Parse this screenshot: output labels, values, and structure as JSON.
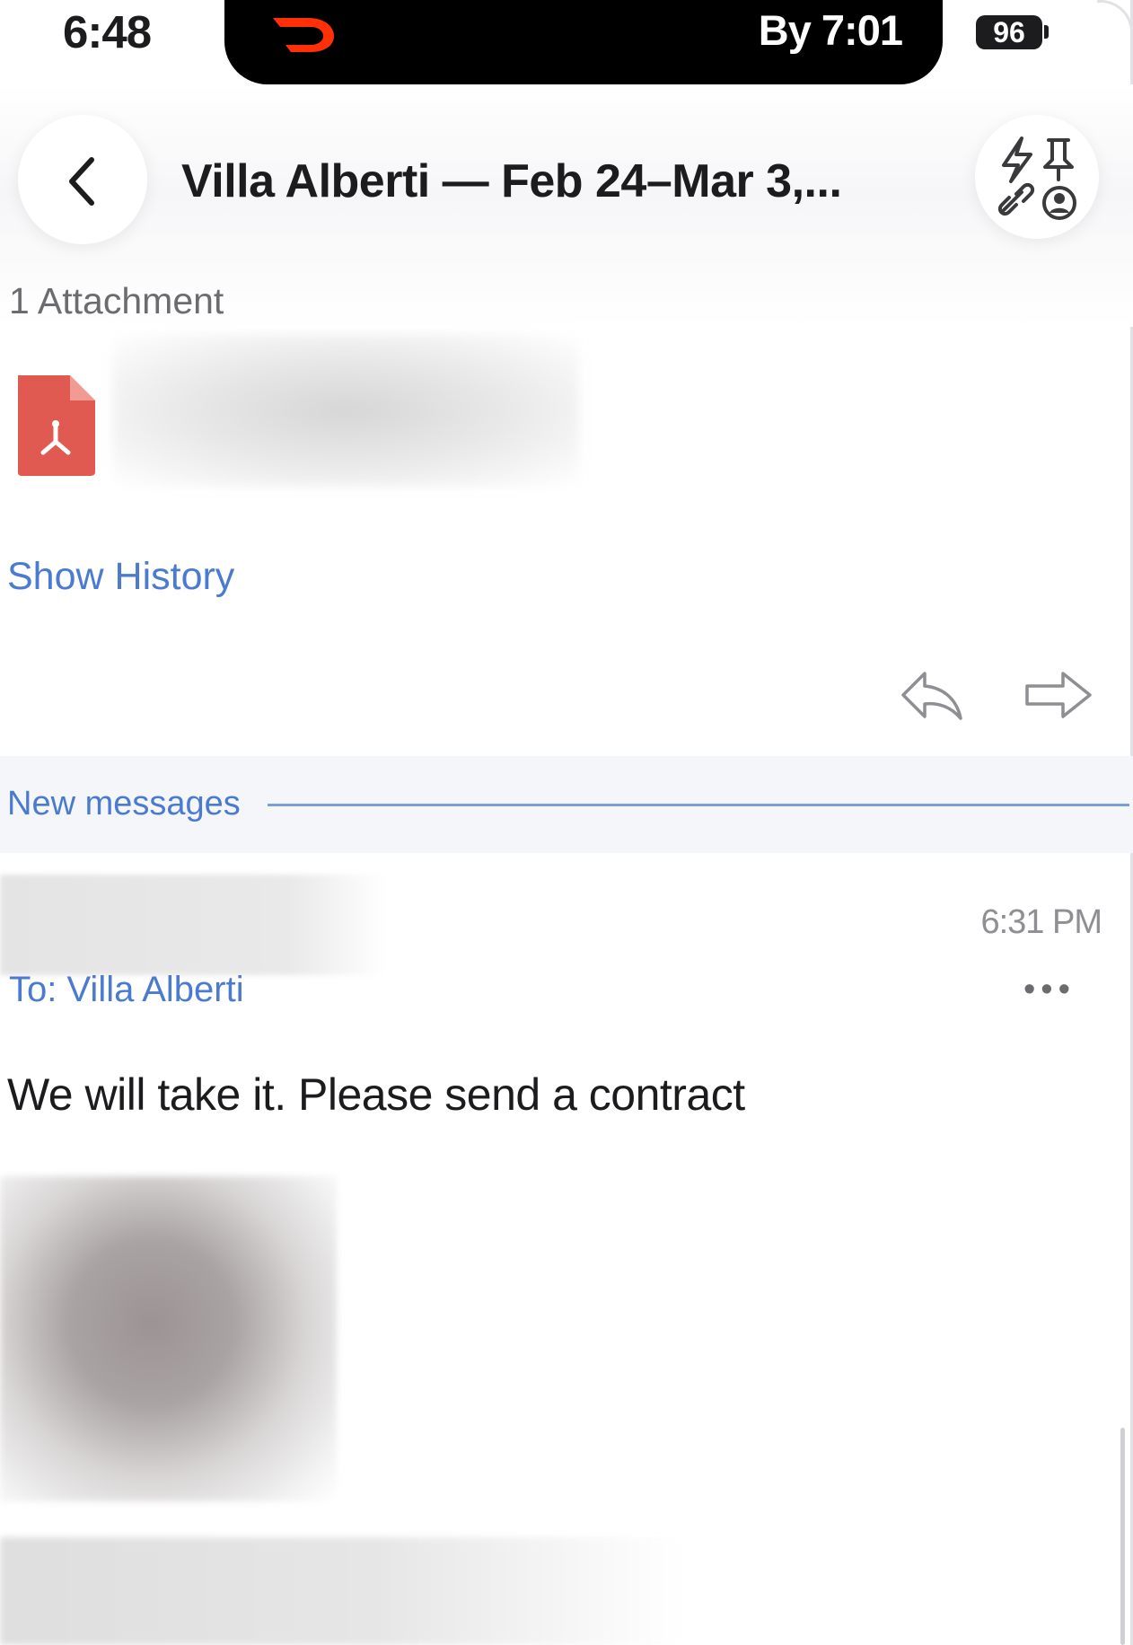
{
  "status_bar": {
    "time": "6:48",
    "live_activity": {
      "app_icon": "doordash-icon",
      "eta": "By 7:01"
    },
    "battery": "96"
  },
  "header": {
    "back_icon": "chevron-left-icon",
    "title": "Villa Alberti — Feb 24–Mar 3,...",
    "quick_actions_icon": "quick-actions-icon"
  },
  "attachments": {
    "count_label": "1 Attachment",
    "file_icon": "pdf-icon"
  },
  "history": {
    "show_label": "Show History"
  },
  "actions": {
    "reply_icon": "reply-icon",
    "forward_icon": "forward-icon"
  },
  "divider": {
    "new_messages_label": "New messages"
  },
  "message": {
    "time": "6:31 PM",
    "recipient": "To: Villa Alberti",
    "more_label": "•••",
    "body": "We will take it. Please send a contract"
  },
  "colors": {
    "accent": "#4a7bd0",
    "pdf_red": "#e05a52",
    "doordash_red": "#ff3008"
  }
}
